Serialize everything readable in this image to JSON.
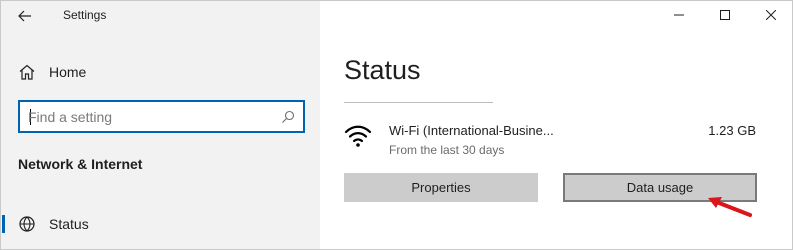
{
  "window": {
    "app_title": "Settings",
    "controls": [
      "minimize-icon",
      "maximize-icon",
      "close-icon"
    ]
  },
  "sidebar": {
    "home_label": "Home",
    "search": {
      "placeholder": "Find a setting",
      "value": ""
    },
    "section_heading": "Network & Internet",
    "items": [
      {
        "label": "Status",
        "icon": "status-globe-icon",
        "selected": true
      }
    ]
  },
  "main": {
    "page_title": "Status",
    "network": {
      "icon": "wifi-icon",
      "name": "Wi-Fi (International-Busine...",
      "subtitle": "From the last 30 days",
      "usage": "1.23 GB"
    },
    "buttons": {
      "properties": "Properties",
      "data_usage": "Data usage"
    }
  },
  "colors": {
    "accent": "#0063b1",
    "sidebar_bg": "#f2f2f2",
    "button_bg": "#cccccc",
    "annotation_arrow": "#d9161c"
  }
}
